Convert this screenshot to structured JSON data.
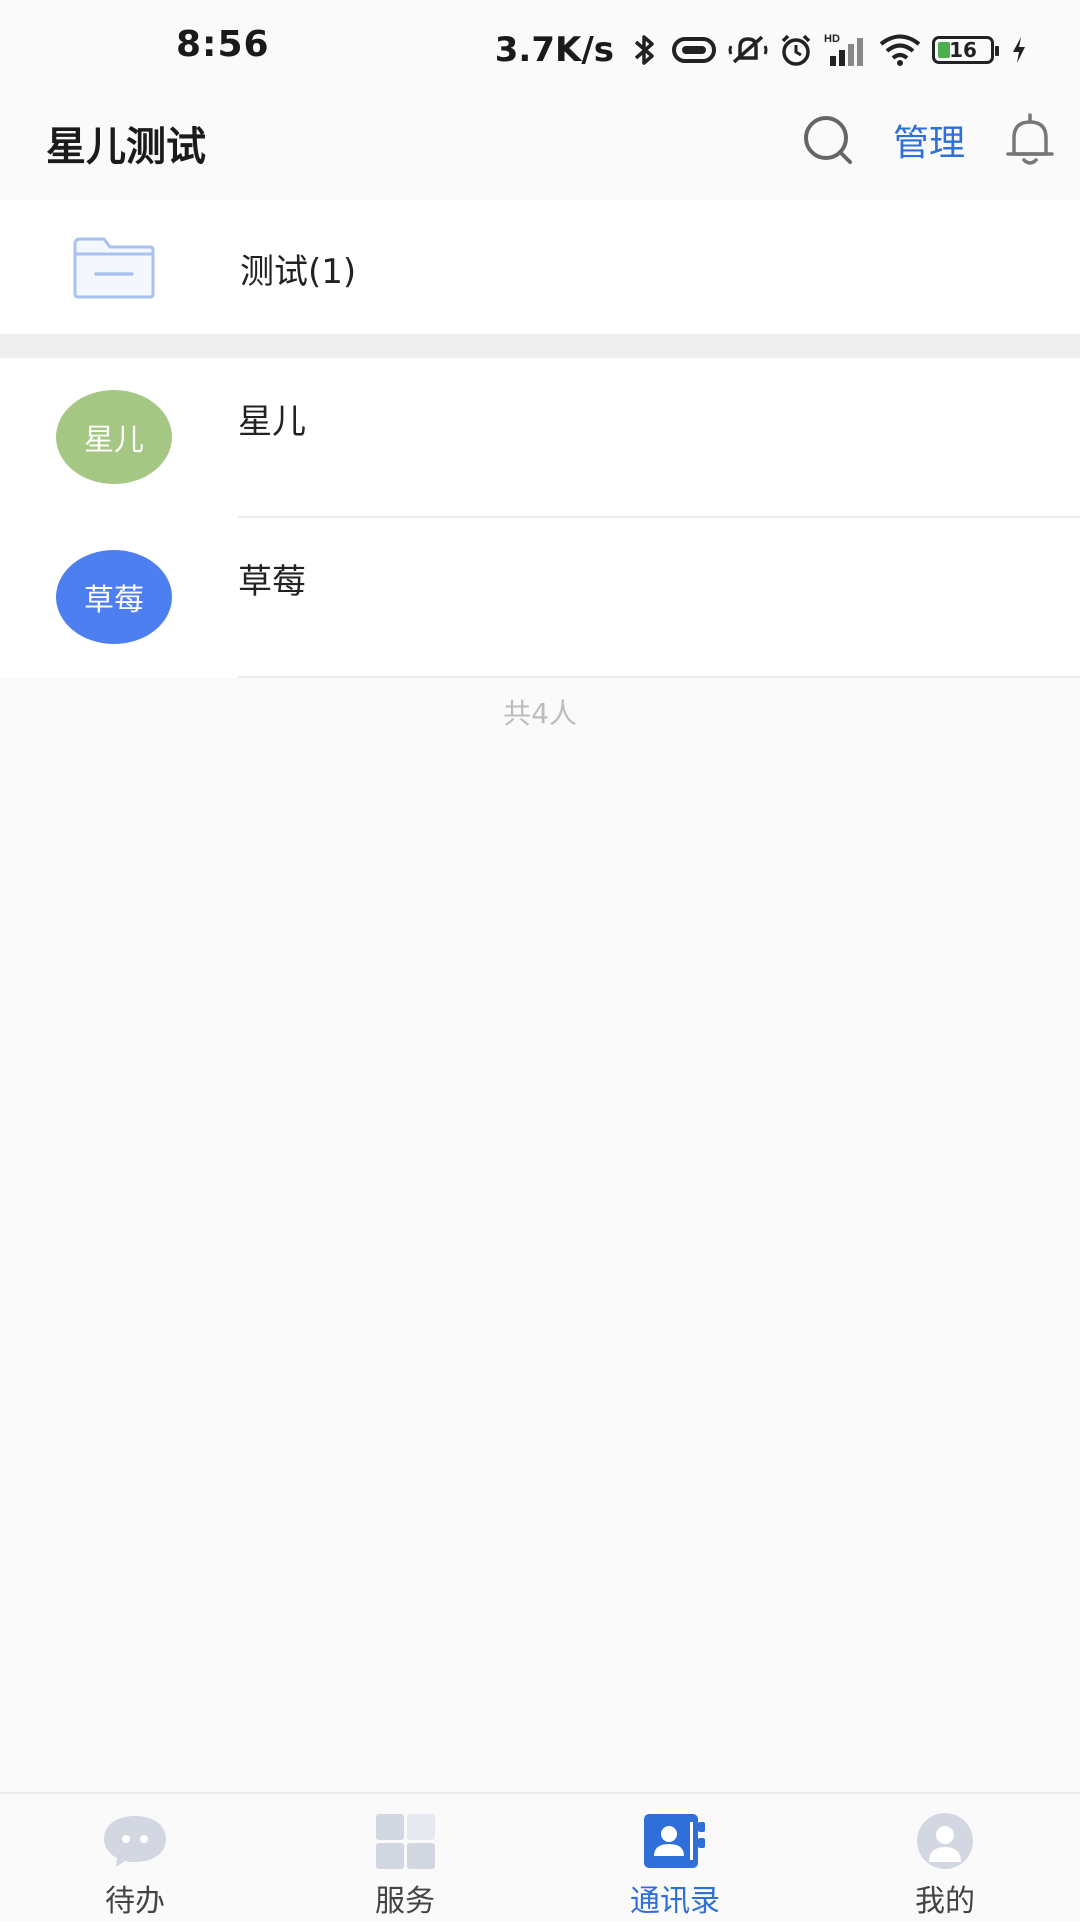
{
  "status_bar": {
    "time": "8:56",
    "net_speed": "3.7K/s",
    "battery_level": "16",
    "icons": [
      "bluetooth-icon",
      "vibrate-icon",
      "mute-icon",
      "alarm-icon",
      "signal-icon",
      "wifi-icon",
      "battery-icon",
      "charging-icon"
    ]
  },
  "header": {
    "title": "星儿测试",
    "manage_label": "管理",
    "search_icon": "search-icon",
    "bell_icon": "bell-icon"
  },
  "department": {
    "label": "测试(1)",
    "icon": "folder-icon"
  },
  "members": [
    {
      "avatar_text": "星儿",
      "name": "星儿",
      "avatar_color": "#a4c883"
    },
    {
      "avatar_text": "草莓",
      "name": "草莓",
      "avatar_color": "#4d7ff0"
    }
  ],
  "total_label": "共4人",
  "bottom_nav": {
    "items": [
      {
        "label": "待办",
        "icon": "chat-bubble-icon",
        "active": false
      },
      {
        "label": "服务",
        "icon": "grid-icon",
        "active": false
      },
      {
        "label": "通讯录",
        "icon": "contacts-icon",
        "active": true
      },
      {
        "label": "我的",
        "icon": "profile-icon",
        "active": false
      }
    ],
    "active_color": "#2f6fd8",
    "inactive_color": "#444444"
  }
}
